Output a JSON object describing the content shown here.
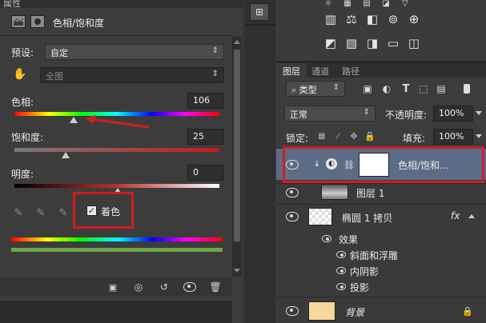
{
  "left_panel": {
    "tab_title": "属性",
    "adjustment_title": "色相/饱和度",
    "preset_label": "预设:",
    "preset_value": "自定",
    "channel_value": "全图",
    "hue_label": "色相:",
    "hue_value": "106",
    "saturation_label": "饱和度:",
    "saturation_value": "25",
    "lightness_label": "明度:",
    "lightness_value": "0",
    "colorize_label": "着色",
    "colorize_checked": true,
    "slider_levels": {
      "hue": 0.3,
      "saturation": 0.25,
      "lightness": 0.5
    }
  },
  "right_panel": {
    "tabs": [
      "图层",
      "通道",
      "路径"
    ],
    "filter_kind": "类型",
    "blend_mode": "正常",
    "opacity_label": "不透明度:",
    "opacity_value": "100%",
    "lock_label": "锁定:",
    "fill_label": "填充:",
    "fill_value": "100%",
    "layers": [
      {
        "name": "色相/饱和…",
        "selected": true
      },
      {
        "name": "图层 1"
      },
      {
        "name": "椭圆 1 拷贝",
        "fx": "fx"
      },
      {
        "name": "效果"
      },
      {
        "name": "斜面和浮雕"
      },
      {
        "name": "内阴影"
      },
      {
        "name": "投影"
      },
      {
        "name": "背景"
      }
    ]
  },
  "colors": {
    "annotation_red": "#d01d22",
    "panel_bg": "#3a3a3a",
    "selected_layer": "#5d6c86"
  }
}
